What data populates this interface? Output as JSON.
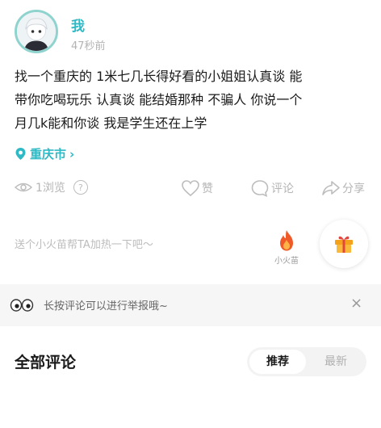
{
  "post": {
    "author": "我",
    "timestamp": "47秒前",
    "body": "找一个重庆的  1米七几长得好看的小姐姐认真谈 能\n带你吃喝玩乐  认真谈 能结婚那种  不骗人  你说一个\n月几k能和你谈   我是学生还在上学",
    "location": "重庆市"
  },
  "stats": {
    "views": "1浏览",
    "like_label": "赞",
    "comment_label": "评论",
    "share_label": "分享"
  },
  "gift": {
    "hint": "送个小火苗帮TA加热一下吧～",
    "fire_label": "小火苗"
  },
  "report": {
    "text": "长按评论可以进行举报哦~",
    "close": "×"
  },
  "comments": {
    "title": "全部评论",
    "sort_options": [
      "推荐",
      "最新"
    ]
  },
  "colors": {
    "accent": "#2fb9c5",
    "muted": "#b5b5b5",
    "fire": "#f05a28",
    "gift": "#f4a21c"
  }
}
